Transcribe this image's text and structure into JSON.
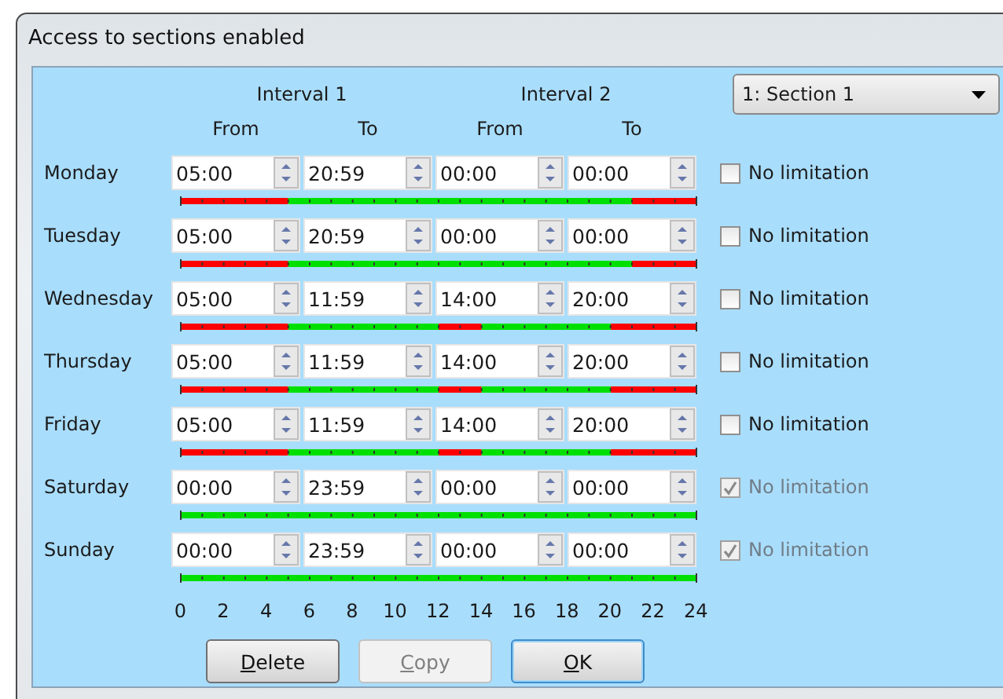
{
  "window": {
    "title": "Access to sections enabled"
  },
  "section_select": {
    "value": "1: Section 1"
  },
  "intervals": [
    {
      "title": "Interval 1",
      "from": "From",
      "to": "To"
    },
    {
      "title": "Interval 2",
      "from": "From",
      "to": "To"
    }
  ],
  "days": [
    {
      "name": "Monday",
      "from_1": "05:00",
      "to_1": "20:59",
      "from_2": "00:00",
      "to_2": "00:00",
      "no_limitation": {
        "label": "No limitation",
        "checked": false,
        "disabled": false
      }
    },
    {
      "name": "Tuesday",
      "from_1": "05:00",
      "to_1": "20:59",
      "from_2": "00:00",
      "to_2": "00:00",
      "no_limitation": {
        "label": "No limitation",
        "checked": false,
        "disabled": false
      }
    },
    {
      "name": "Wednesday",
      "from_1": "05:00",
      "to_1": "11:59",
      "from_2": "14:00",
      "to_2": "20:00",
      "no_limitation": {
        "label": "No limitation",
        "checked": false,
        "disabled": false
      }
    },
    {
      "name": "Thursday",
      "from_1": "05:00",
      "to_1": "11:59",
      "from_2": "14:00",
      "to_2": "20:00",
      "no_limitation": {
        "label": "No limitation",
        "checked": false,
        "disabled": false
      }
    },
    {
      "name": "Friday",
      "from_1": "05:00",
      "to_1": "11:59",
      "from_2": "14:00",
      "to_2": "20:00",
      "no_limitation": {
        "label": "No limitation",
        "checked": false,
        "disabled": false
      }
    },
    {
      "name": "Saturday",
      "from_1": "00:00",
      "to_1": "23:59",
      "from_2": "00:00",
      "to_2": "00:00",
      "no_limitation": {
        "label": "No limitation",
        "checked": true,
        "disabled": true
      }
    },
    {
      "name": "Sunday",
      "from_1": "00:00",
      "to_1": "23:59",
      "from_2": "00:00",
      "to_2": "00:00",
      "no_limitation": {
        "label": "No limitation",
        "checked": true,
        "disabled": true
      }
    }
  ],
  "axis_labels": [
    "0",
    "2",
    "4",
    "6",
    "8",
    "10",
    "12",
    "14",
    "16",
    "18",
    "20",
    "22",
    "24"
  ],
  "buttons": [
    {
      "mnemonic": "D",
      "rest": "elete",
      "disabled": false,
      "default": false
    },
    {
      "mnemonic": "C",
      "rest": "opy",
      "disabled": true,
      "default": false
    },
    {
      "mnemonic": "O",
      "rest": "K",
      "disabled": false,
      "default": true
    }
  ]
}
